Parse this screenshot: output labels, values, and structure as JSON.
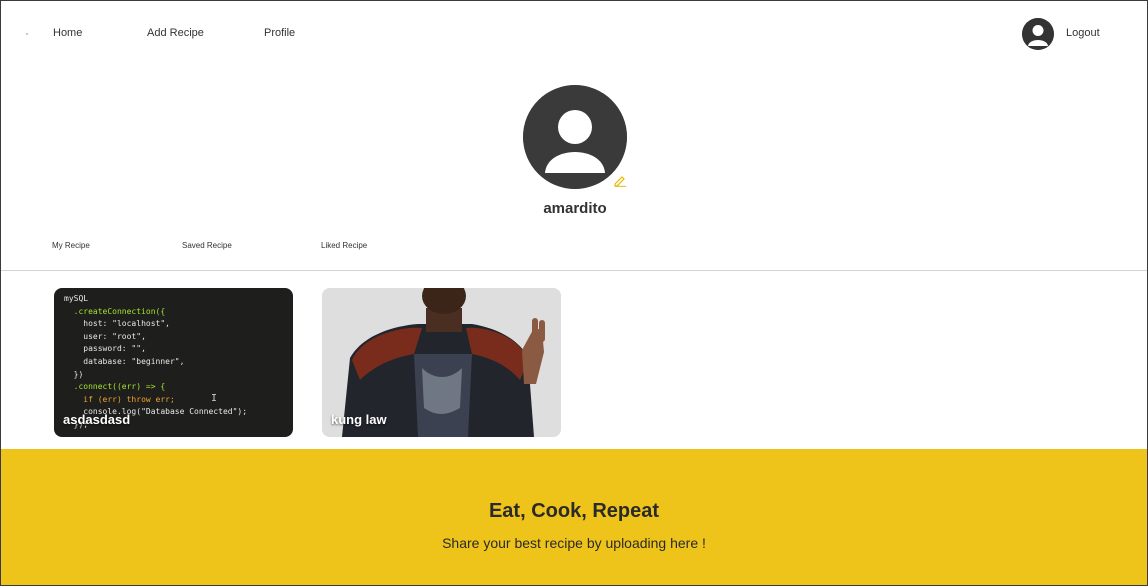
{
  "nav": {
    "home": "Home",
    "add_recipe": "Add Recipe",
    "profile": "Profile",
    "logout": "Logout"
  },
  "profile": {
    "username": "amardito"
  },
  "tabs": [
    {
      "label": "My Recipe"
    },
    {
      "label": "Saved Recipe"
    },
    {
      "label": "Liked Recipe"
    }
  ],
  "recipes": [
    {
      "title": "asdasdasd",
      "code_lines": [
        "mySQL",
        "  .createConnection({",
        "    host: \"localhost\",",
        "    user: \"root\",",
        "    password: \"\",",
        "    database: \"beginner\",",
        "  })",
        "  .connect((err) => {",
        "    if (err) throw err;",
        "    console.log(\"Database Connected\");",
        "  });"
      ]
    },
    {
      "title": "kung law"
    }
  ],
  "footer": {
    "title": "Eat, Cook, Repeat",
    "subtitle": "Share your best recipe by uploading here !"
  },
  "colors": {
    "accent": "#efc41a",
    "edit_icon": "#e6b800",
    "avatar_bg": "#3a3a3a"
  }
}
